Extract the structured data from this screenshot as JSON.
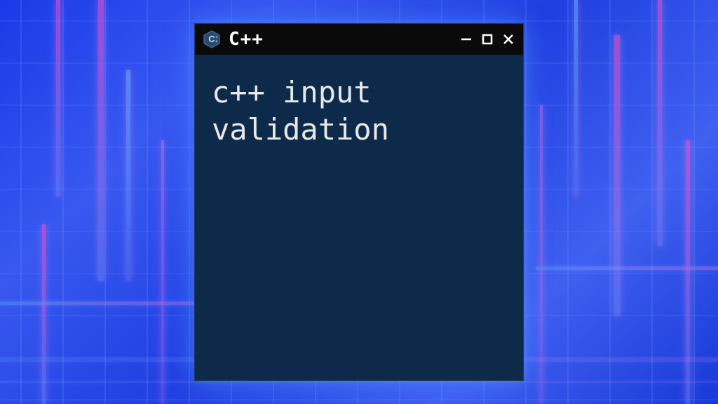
{
  "window": {
    "title": "C++",
    "icon_name": "cpp-icon"
  },
  "terminal": {
    "content": "c++ input validation"
  },
  "colors": {
    "terminal_bg": "#0e2a4a",
    "titlebar_bg": "#0a0a0a",
    "text_color": "#e8e8e8",
    "cpp_icon_color": "#5a8fc7"
  }
}
